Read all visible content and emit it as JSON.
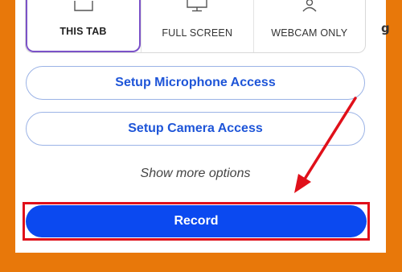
{
  "tabs": [
    {
      "label": "THIS TAB",
      "icon": "browser-tab-icon",
      "active": true
    },
    {
      "label": "FULL SCREEN",
      "icon": "monitor-icon",
      "active": false
    },
    {
      "label": "WEBCAM ONLY",
      "icon": "webcam-icon",
      "active": false
    }
  ],
  "cut_off_text": "g",
  "buttons": {
    "microphone": "Setup Microphone Access",
    "camera": "Setup Camera Access",
    "more_options": "Show more options",
    "record": "Record"
  },
  "colors": {
    "background_frame": "#e8780a",
    "accent_blue": "#1e55d8",
    "record_blue": "#0b49f0",
    "active_tab_border": "#7b52c8",
    "highlight_red": "#e0101a"
  },
  "annotation": {
    "arrow_color": "#e0101a",
    "highlight": "record-button"
  }
}
